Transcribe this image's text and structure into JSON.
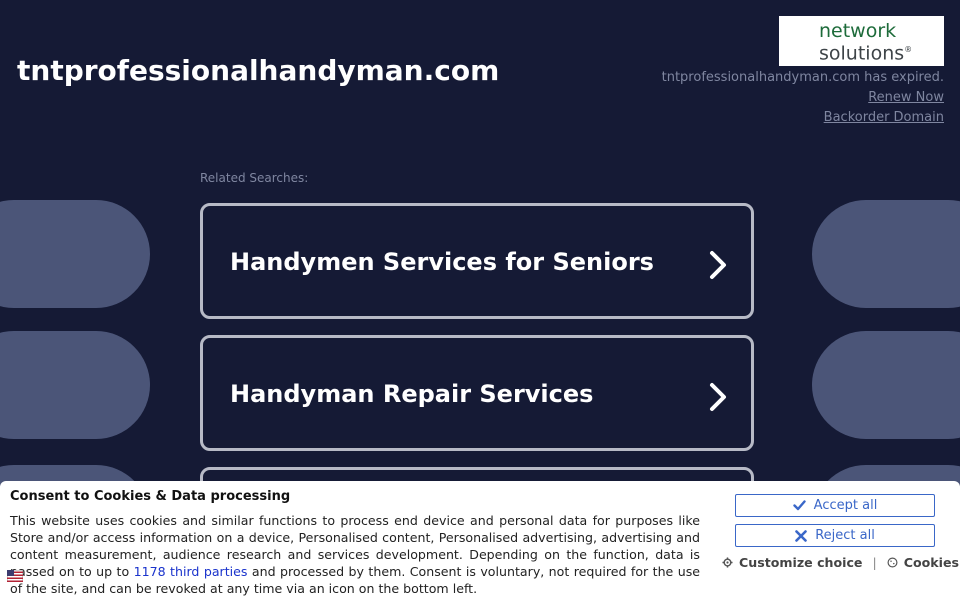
{
  "header": {
    "domain": "tntprofessionalhandyman.com"
  },
  "logo": {
    "line1": "network",
    "line2": "solutions"
  },
  "expiry": {
    "message": "tntprofessionalhandyman.com has expired.",
    "renew_label": "Renew Now",
    "backorder_label": "Backorder Domain"
  },
  "related": {
    "label": "Related Searches:",
    "items": [
      {
        "label": "Handymen Services for Seniors"
      },
      {
        "label": "Handyman Repair Services"
      },
      {
        "label": ""
      }
    ]
  },
  "consent": {
    "title": "Consent to Cookies & Data processing",
    "body_before": "This website uses cookies and similar functions to process end device and personal data for purposes like Store and/or access information on a device, Personalised content, Personalised advertising, advertising and content measurement, audience research and services development. Depending on the function, data is passed on to up to ",
    "third_parties_link": "1178 third parties",
    "body_after": " and processed by them. Consent is voluntary, not required for the use of the site, and can be revoked at any time via an icon on the bottom left.",
    "accept_label": "Accept all",
    "reject_label": "Reject all",
    "customize_label": "Customize choice",
    "separator": "|",
    "cookies_label": "Cookies"
  },
  "colors": {
    "background": "#151a35",
    "blob": "#4b5578",
    "accent_blue": "#3a67c8",
    "logo_green": "#1d6b3a"
  },
  "icons": {
    "chevron": "chevron-right-icon",
    "accept": "checkmark-icon",
    "reject": "x-icon",
    "customize": "gear-icon",
    "cookies": "cookie-icon",
    "flag": "flag-icon"
  }
}
